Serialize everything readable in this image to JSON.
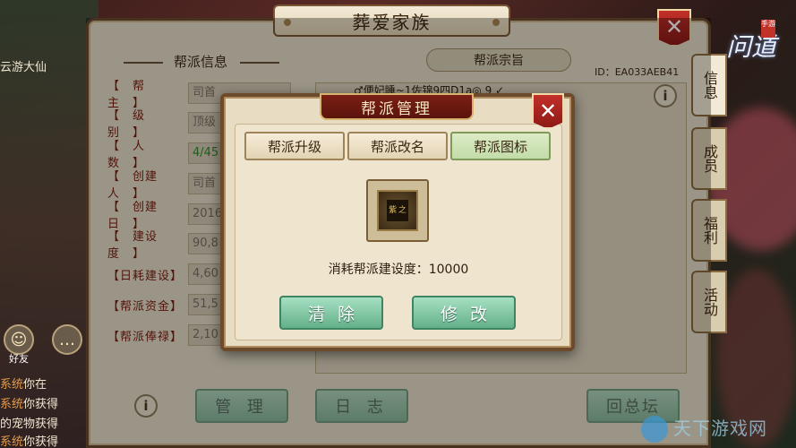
{
  "main_title": "葬爱家族",
  "left_section_title": "帮派信息",
  "info_rows": [
    {
      "label": "【　帮　主　】",
      "value": "司首",
      "green": false
    },
    {
      "label": "【　级　别　】",
      "value": "顶级",
      "green": false
    },
    {
      "label": "【　人　数　】",
      "value": "4/45",
      "green": true
    },
    {
      "label": "【　创建人　】",
      "value": "司首",
      "green": false
    },
    {
      "label": "【　创建日　】",
      "value": "2016",
      "green": false
    },
    {
      "label": "【　建设度　】",
      "value": "90,8",
      "green": false
    },
    {
      "label": "【日耗建设】",
      "value": "4,60",
      "green": false
    },
    {
      "label": "【帮派资金】",
      "value": "51,5",
      "green": false
    },
    {
      "label": "【帮派俸禄】",
      "value": "2,10",
      "green": false
    }
  ],
  "purpose_tab": "帮派宗旨",
  "guild_id": "ID：EA033AEB41",
  "purpose_text": "♂便妃睡~1佐锦9四D1a◎ 9 ✓",
  "side_tabs": [
    {
      "label": "信息",
      "active": true
    },
    {
      "label": "成员",
      "active": false
    },
    {
      "label": "福利",
      "active": false
    },
    {
      "label": "活动",
      "active": false
    }
  ],
  "bottom_buttons": {
    "manage": "管 理",
    "log": "日 志",
    "back": "回总坛"
  },
  "modal": {
    "title": "帮派管理",
    "tabs": [
      "帮派升级",
      "帮派改名",
      "帮派图标"
    ],
    "active_tab": 2,
    "emblem_text": "紫 之",
    "cost_label": "消耗帮派建设度：10000",
    "clear_btn": "清除",
    "modify_btn": "修改"
  },
  "chat": {
    "top_label": "云游大仙",
    "friend_label": "好友",
    "lines": [
      {
        "tag": "系统",
        "text": "你在"
      },
      {
        "tag": "系统",
        "text": "你获得"
      },
      {
        "tag": "",
        "text": "的宠物获得"
      },
      {
        "tag": "系统",
        "text": "你获得"
      }
    ]
  },
  "logo_text": "问道",
  "logo_badge": "手游",
  "watermark": "天下游戏网",
  "colors": {
    "panel_bg": "#e5dcc7",
    "modal_title_bg": "#7a1f14",
    "close_red": "#c2302a",
    "label_red": "#7a1c10",
    "button_green": "#63b08a"
  }
}
